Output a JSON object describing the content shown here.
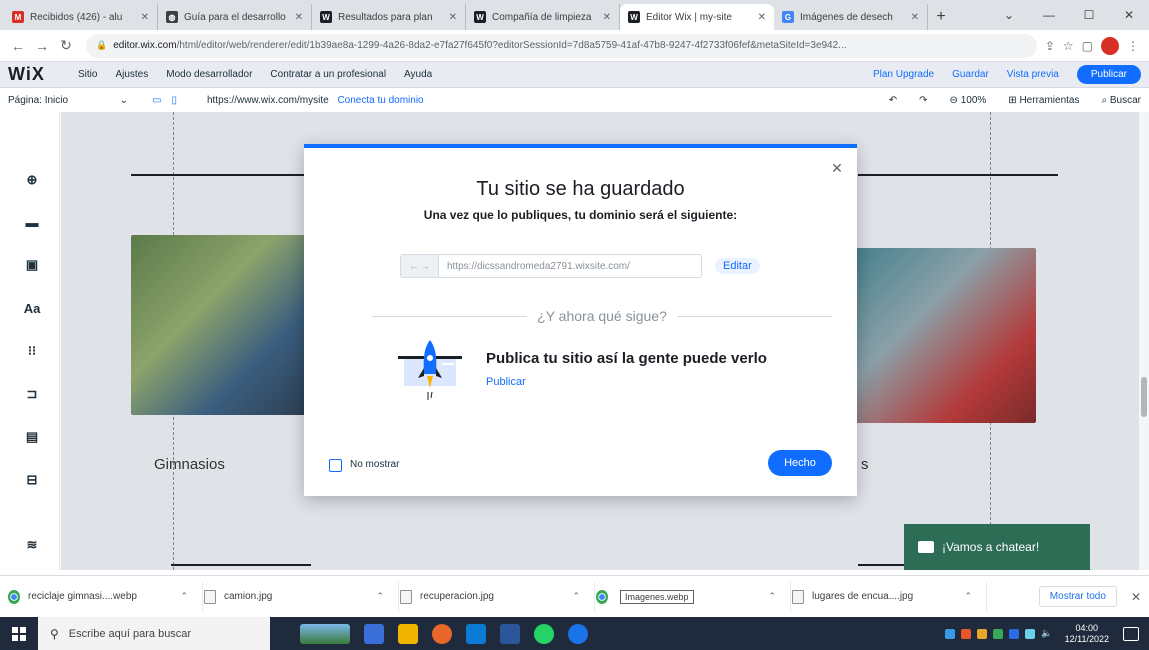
{
  "browser": {
    "tabs": [
      {
        "title": "Recibidos (426) - alu",
        "favicon": "gmail-icon",
        "color": "#d93025",
        "active": false
      },
      {
        "title": "Guía para el desarrollo",
        "favicon": "globe-icon",
        "color": "#3c4043",
        "active": false
      },
      {
        "title": "Resultados para plan",
        "favicon": "wix-icon",
        "color": "#1b1e24",
        "active": false
      },
      {
        "title": "Compañía de limpieza",
        "favicon": "wix-icon",
        "color": "#1b1e24",
        "active": false
      },
      {
        "title": "Editor Wix | my-site",
        "favicon": "wix-icon",
        "color": "#1b1e24",
        "active": true
      },
      {
        "title": "Imágenes de desech",
        "favicon": "google-icon",
        "color": "#4285f4",
        "active": false
      }
    ],
    "url_host": "editor.wix.com",
    "url_path": "/html/editor/web/renderer/edit/1b39ae8a-1299-4a26-8da2-e7fa27f645f0?editorSessionId=7d8a5759-41af-47b8-9247-4f2733f06fef&metaSiteId=3e942..."
  },
  "wix": {
    "logo": "WiX",
    "menu": [
      "Sitio",
      "Ajustes",
      "Modo desarrollador",
      "Contratar a un profesional",
      "Ayuda"
    ],
    "right_links": [
      "Plan Upgrade",
      "Guardar",
      "Vista previa"
    ],
    "publish_label": "Publicar",
    "page_select": "Página: Inicio",
    "site_url": "https://www.wix.com/mysite",
    "connect_domain": "Conecta tu dominio",
    "zoom": "100%",
    "tools": "Herramientas",
    "search": "Buscar"
  },
  "canvas": {
    "gym_label": "Gimnasios",
    "right_label_suffix": "s",
    "chat_label": "¡Vamos a chatear!"
  },
  "modal": {
    "title": "Tu sitio se ha guardado",
    "subtitle": "Una vez que lo publiques, tu dominio será el siguiente:",
    "domain": "https://dicssandromeda2791.wixsite.com/",
    "edit_label": "Editar",
    "next_heading": "¿Y ahora qué sigue?",
    "next_title": "Publica tu sitio así la gente puede verlo",
    "next_link": "Publicar",
    "dont_show": "No mostrar",
    "done_label": "Hecho"
  },
  "downloads": {
    "items": [
      {
        "name": "reciclaje gimnasi....webp",
        "type": "chrome"
      },
      {
        "name": "camion.jpg",
        "type": "file"
      },
      {
        "name": "recuperacion.jpg",
        "type": "file"
      },
      {
        "name": "",
        "type": "chrome",
        "tooltip": "Imagenes.webp"
      },
      {
        "name": "lugares de encua....jpg",
        "type": "file"
      }
    ],
    "show_all": "Mostrar todo"
  },
  "taskbar": {
    "search_placeholder": "Escribe aquí para buscar",
    "time": "04:00",
    "date": "12/11/2022"
  },
  "colors": {
    "accent": "#116dff",
    "chat": "#2d6c55"
  }
}
